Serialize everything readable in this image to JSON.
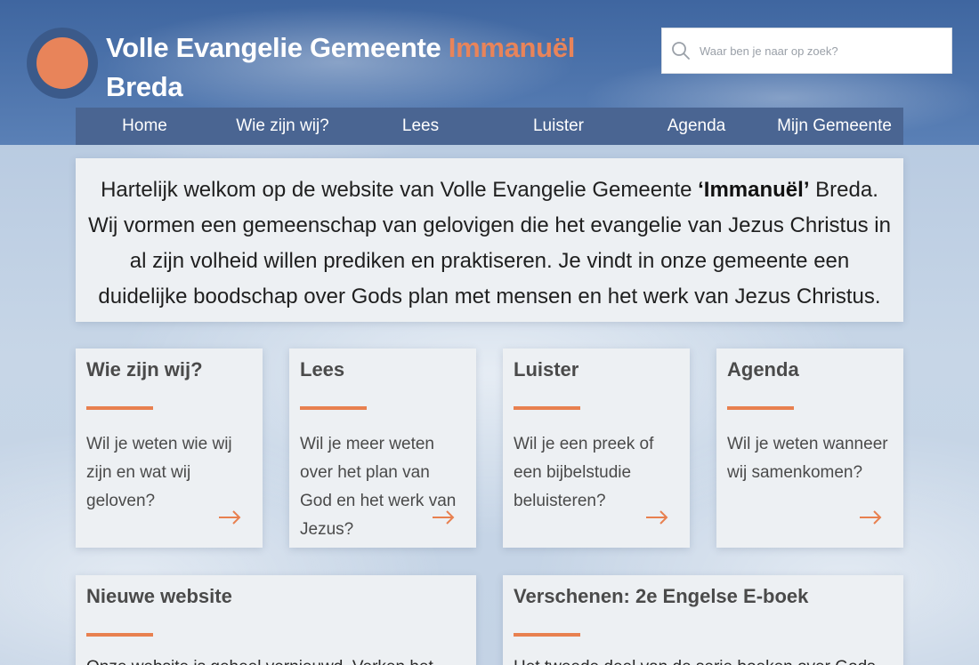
{
  "header": {
    "title_main": "Volle Evangelie Gemeente ",
    "title_accent": "Immanuël",
    "title_city": "Breda",
    "search_placeholder": "Waar ben je naar op zoek?"
  },
  "nav": {
    "items": [
      {
        "label": "Home"
      },
      {
        "label": "Wie zijn wij?"
      },
      {
        "label": "Lees"
      },
      {
        "label": "Luister"
      },
      {
        "label": "Agenda"
      },
      {
        "label": "Mijn Gemeente"
      }
    ]
  },
  "intro": {
    "before": "Hartelijk welkom op de website van Volle Evangelie Gemeente ",
    "highlight": "‘Immanuël’",
    "after": " Breda. Wij vormen een gemeenschap van gelovigen die het evangelie van Jezus Christus in al zijn volheid willen prediken en praktiseren. Je vindt in onze gemeente een duidelijke boodschap over Gods plan met mensen en het werk van Jezus Christus."
  },
  "cards": [
    {
      "title": "Wie zijn wij?",
      "text": "Wil je weten wie wij zijn en wat wij geloven?"
    },
    {
      "title": "Lees",
      "text": "Wil je meer weten over het plan van God en het werk van Jezus?"
    },
    {
      "title": "Luister",
      "text": "Wil je een preek of een bijbelstudie beluisteren?"
    },
    {
      "title": "Agenda",
      "text": "Wil je weten wanneer wij samenkomen?"
    }
  ],
  "news": [
    {
      "title": "Nieuwe website",
      "text": "Onze website is geheel vernieuwd. Verken het"
    },
    {
      "title": "Verschenen: 2e Engelse E-boek",
      "text": "Het tweede deel van de serie boeken over Gods"
    }
  ],
  "colors": {
    "accent": "#e8845a",
    "nav_bg": "#4a6592",
    "card_bg": "#edf0f3"
  }
}
